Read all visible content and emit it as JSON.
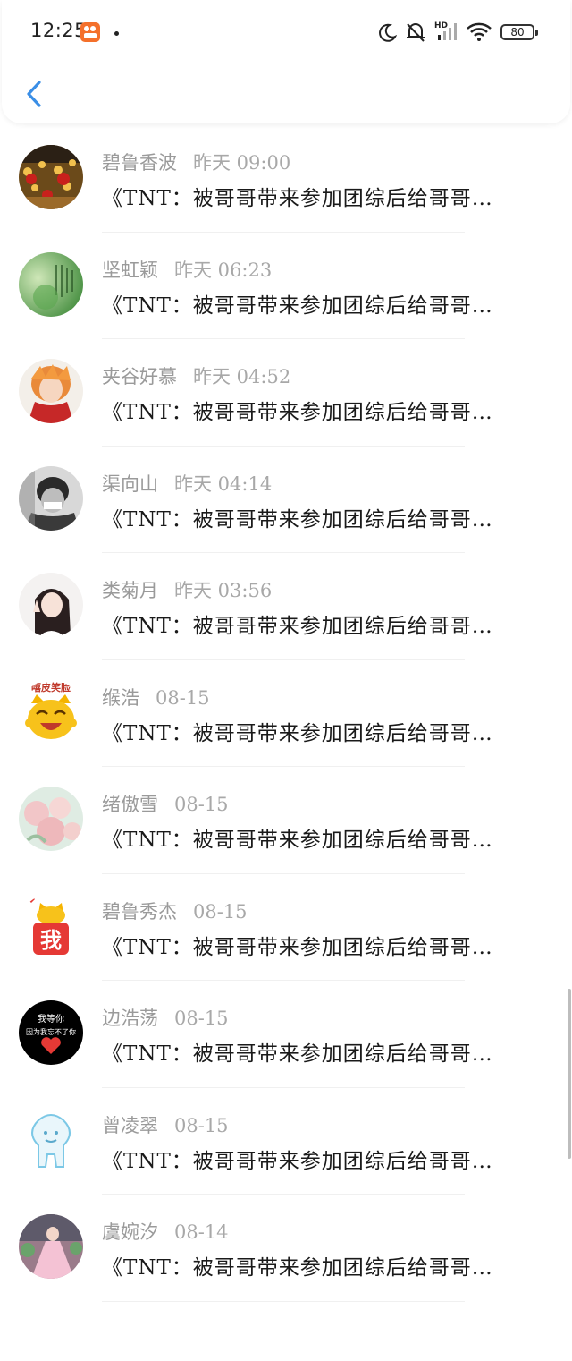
{
  "status_bar": {
    "time": "12:25",
    "battery": "80"
  },
  "messages": [
    {
      "name": "碧鲁香波",
      "time": "昨天 09:00",
      "text": "《TNT：被哥哥带来参加团综后给哥哥…",
      "avatar": "lanterns-avatar"
    },
    {
      "name": "坚虹颖",
      "time": "昨天 06:23",
      "text": "《TNT：被哥哥带来参加团综后给哥哥…",
      "avatar": "green-poem-avatar"
    },
    {
      "name": "夹谷好慕",
      "time": "昨天 04:52",
      "text": "《TNT：被哥哥带来参加团综后给哥哥…",
      "avatar": "orange-hair-avatar"
    },
    {
      "name": "渠向山",
      "time": "昨天 04:14",
      "text": "《TNT：被哥哥带来参加团综后给哥哥…",
      "avatar": "bw-boy-avatar"
    },
    {
      "name": "类菊月",
      "time": "昨天 03:56",
      "text": "《TNT：被哥哥带来参加团综后给哥哥…",
      "avatar": "girl-avatar"
    },
    {
      "name": "缑浩",
      "time": "08-15",
      "text": "《TNT：被哥哥带来参加团综后给哥哥…",
      "avatar": "smiling-cat-avatar"
    },
    {
      "name": "绪傲雪",
      "time": "08-15",
      "text": "《TNT：被哥哥带来参加团综后给哥哥…",
      "avatar": "roses-avatar"
    },
    {
      "name": "碧鲁秀杰",
      "time": "08-15",
      "text": "《TNT：被哥哥带来参加团综后给哥哥…",
      "avatar": "cat-me-avatar"
    },
    {
      "name": "边浩荡",
      "time": "08-15",
      "text": "《TNT：被哥哥带来参加团综后给哥哥…",
      "avatar": "black-heart-avatar"
    },
    {
      "name": "曾凌翠",
      "time": "08-15",
      "text": "《TNT：被哥哥带来参加团综后给哥哥…",
      "avatar": "blue-doodle-avatar"
    },
    {
      "name": "虞婉汐",
      "time": "08-14",
      "text": "《TNT：被哥哥带来参加团综后给哥哥…",
      "avatar": "pink-dress-avatar"
    }
  ],
  "avatar_texts": {
    "smiling_cat": "嘻皮笑脸",
    "cat_me": "我",
    "black_heart_1": "我等你",
    "black_heart_2": "因为我忘不了你"
  },
  "colors": {
    "accent": "#3a8ee6",
    "name_gray": "#9a9a9a",
    "message_text": "#1a1a1a"
  }
}
